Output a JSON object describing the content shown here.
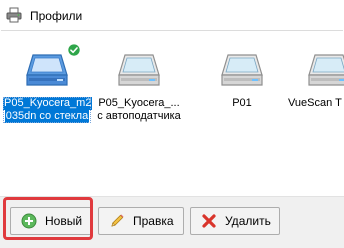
{
  "window": {
    "title": "Профили",
    "title_icon": "printer-icon"
  },
  "profiles": [
    {
      "line1": "P05_Kyocera_m2",
      "line2": "035dn со стекла",
      "icon": "flatbed-scanner-icon",
      "selected": true,
      "badge": "checkmark-icon"
    },
    {
      "line1": "P05_Kyocera_...",
      "line2": "с автоподатчика",
      "icon": "flatbed-scanner-icon",
      "selected": false
    },
    {
      "line1": "P01",
      "line2": "",
      "icon": "flatbed-scanner-icon",
      "selected": false
    },
    {
      "line1": "VueScan T",
      "line2": "",
      "icon": "flatbed-scanner-icon",
      "selected": false
    }
  ],
  "toolbar": {
    "new_label": "Новый",
    "new_icon": "plus-circle-icon",
    "edit_label": "Правка",
    "edit_icon": "pencil-icon",
    "delete_label": "Удалить",
    "delete_icon": "x-icon"
  },
  "colors": {
    "selection": "#0078d7",
    "highlight_box": "#e03a3e",
    "scanner_selected": "#4a90d9",
    "check_badge": "#2fa64a",
    "add_icon": "#4caf50",
    "delete_icon": "#d9342b"
  }
}
